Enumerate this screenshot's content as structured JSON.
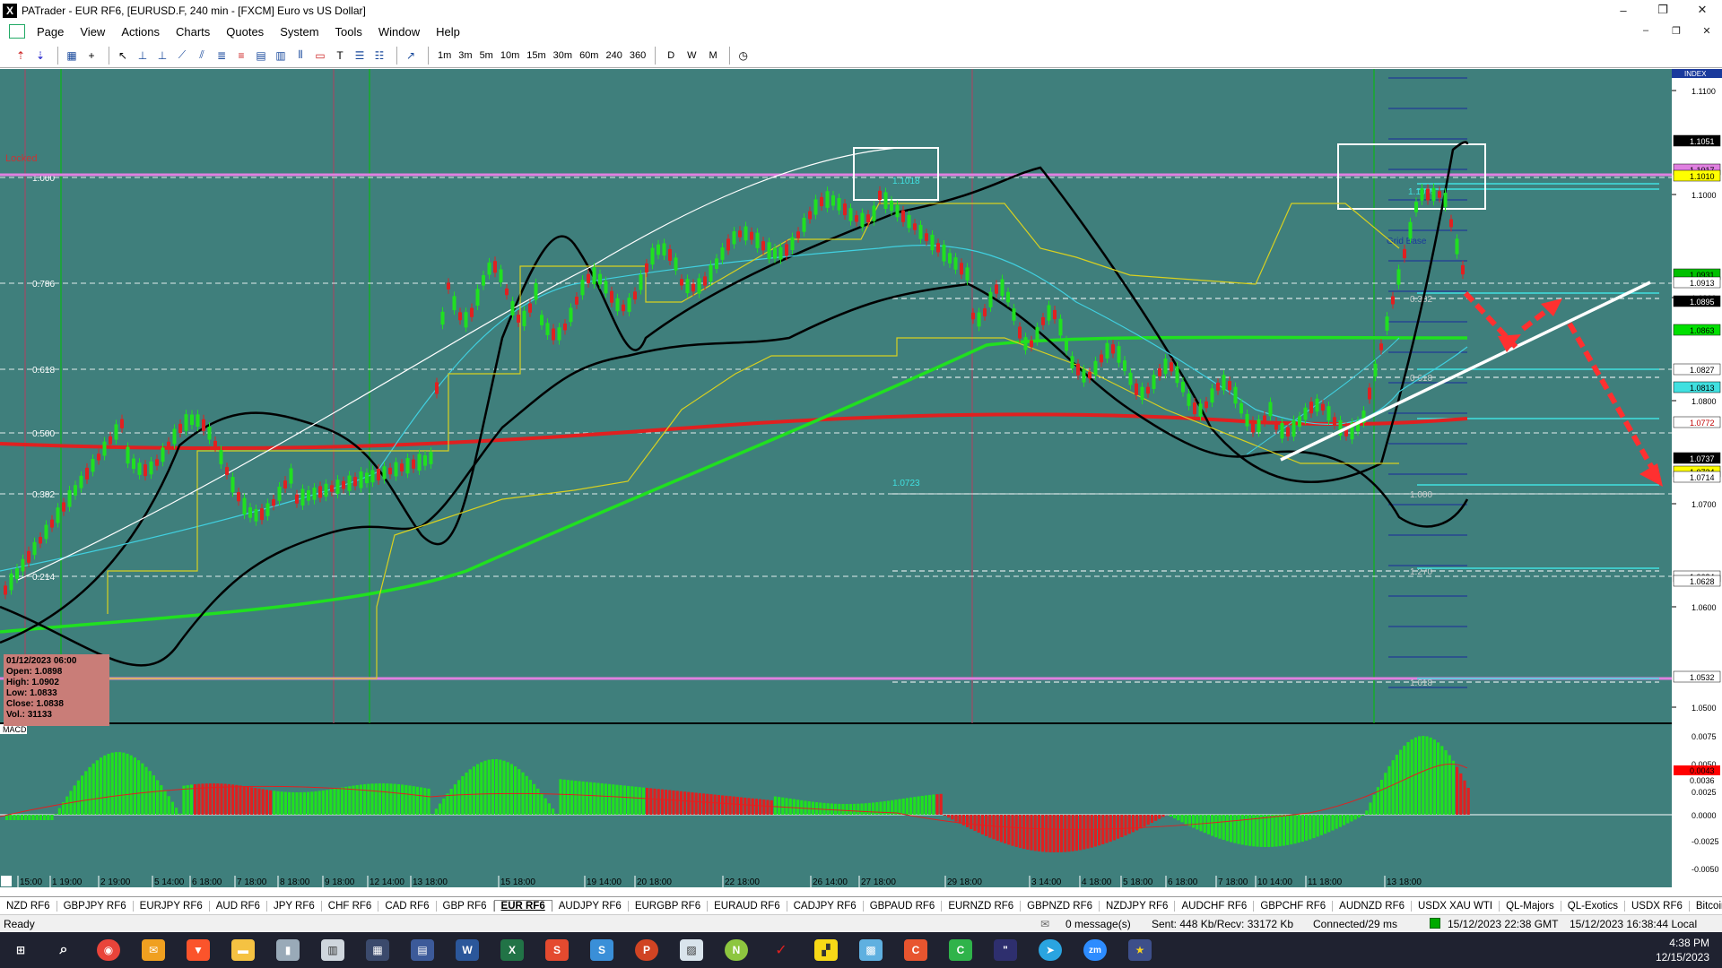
{
  "window": {
    "app_logo": "X",
    "title": "PATrader - EUR RF6, [EURUSD.F, 240 min - [FXCM] Euro vs US Dollar]",
    "minimize": "–",
    "restore": "❐",
    "close": "✕",
    "child_minimize": "–",
    "child_restore": "❐",
    "child_close": "✕"
  },
  "menu": [
    "Page",
    "View",
    "Actions",
    "Charts",
    "Quotes",
    "System",
    "Tools",
    "Window",
    "Help"
  ],
  "toolbar": {
    "timeframes": [
      "1m",
      "3m",
      "5m",
      "10m",
      "15m",
      "30m",
      "60m",
      "240",
      "360"
    ],
    "periods": [
      "D",
      "W",
      "M"
    ]
  },
  "chart": {
    "locked_label": "Locked",
    "index_label": "INDEX",
    "macd_label": "MACD",
    "price_scale": [
      "1.1100",
      "1.1000",
      "1.0900",
      "1.0800",
      "1.0700",
      "1.0600",
      "1.0500"
    ],
    "price_tags": [
      {
        "text": "1.1051",
        "bg": "#000000",
        "fg": "#ffffff"
      },
      {
        "text": "1.1017",
        "bg": "#e080e0",
        "fg": "#000000"
      },
      {
        "text": "1.1010",
        "bg": "#ffff00",
        "fg": "#000000"
      },
      {
        "text": "1.0931",
        "bg": "#00c000",
        "fg": "#000000"
      },
      {
        "text": "1.0913",
        "bg": "#ffffff",
        "fg": "#000000"
      },
      {
        "text": "1.0895",
        "bg": "#000000",
        "fg": "#ffffff"
      },
      {
        "text": "1.0863",
        "bg": "#00e000",
        "fg": "#000000"
      },
      {
        "text": "1.0827",
        "bg": "#ffffff",
        "fg": "#000000"
      },
      {
        "text": "1.0813",
        "bg": "#40e0e0",
        "fg": "#000000"
      },
      {
        "text": "1.0772",
        "bg": "#ffffff",
        "fg": "#c00000"
      },
      {
        "text": "1.0737",
        "bg": "#000000",
        "fg": "#ffffff"
      },
      {
        "text": "1.0724",
        "bg": "#ffff00",
        "fg": "#000000"
      },
      {
        "text": "1.0714",
        "bg": "#ffffff",
        "fg": "#000000"
      },
      {
        "text": "1.0634",
        "bg": "#ffffff",
        "fg": "#000000"
      },
      {
        "text": "1.0628",
        "bg": "#ffffff",
        "fg": "#000000"
      },
      {
        "text": "1.0532",
        "bg": "#ffffff",
        "fg": "#000000"
      }
    ],
    "fib_left": [
      "1.000",
      "0.786",
      "0.618",
      "0.500",
      "0.382",
      "0.214"
    ],
    "fib_right": [
      "0.382",
      "0.618",
      "1.000",
      "1.270",
      "1.618"
    ],
    "fib_mid": [
      "1.1018",
      "1.0723",
      "1.1009",
      "Grid Base"
    ],
    "time_labels": [
      "15:00",
      "1 19:00",
      "2 19:00",
      "5 14:00",
      "6 18:00",
      "7 18:00",
      "8 18:00",
      "9 18:00",
      "12 14:00",
      "13 18:00",
      "15 18:00",
      "19 14:00",
      "20 18:00",
      "22 18:00",
      "26 14:00",
      "27 18:00",
      "29 18:00",
      "3 14:00",
      "4 18:00",
      "5 18:00",
      "6 18:00",
      "7 18:00",
      "10 14:00",
      "11 18:00",
      "13 18:00"
    ],
    "macd_scale": [
      "0.0075",
      "0.0050",
      "0.0025",
      "0.0000",
      "-0.0025",
      "-0.0050"
    ],
    "macd_tags": [
      {
        "text": "0.0043",
        "bg": "#ff0000",
        "fg": "#000000"
      },
      {
        "text": "0.0036",
        "bg": "#ffffff",
        "fg": "#000000"
      }
    ]
  },
  "ohlc": {
    "date": "01/12/2023 06:00",
    "open": "Open: 1.0898",
    "high": "High: 1.0902",
    "low": "Low: 1.0833",
    "close": "Close: 1.0838",
    "vol": "Vol.: 31133"
  },
  "symbol_tabs": [
    "NZD RF6",
    "GBPJPY RF6",
    "EURJPY RF6",
    "AUD RF6",
    "JPY RF6",
    "CHF RF6",
    "CAD RF6",
    "GBP RF6",
    "EUR RF6",
    "AUDJPY RF6",
    "EURGBP RF6",
    "EURAUD RF6",
    "CADJPY RF6",
    "GBPAUD RF6",
    "EURNZD RF6",
    "GBPNZD RF6",
    "NZDJPY RF6",
    "AUDCHF RF6",
    "GBPCHF RF6",
    "AUDNZD RF6",
    "USDX XAU WTI",
    "QL-Majors",
    "QL-Exotics",
    "USDX RF6",
    "Bitcoin",
    "SP500",
    "DJIA"
  ],
  "active_tab": "EUR RF6",
  "status": {
    "ready": "Ready",
    "messages": "0 message(s)",
    "sent": "Sent: 448 Kb/Recv: 33172 Kb",
    "connected": "Connected/29 ms",
    "gmt": "15/12/2023 22:38 GMT",
    "local": "15/12/2023 16:38:44 Local"
  },
  "clock": {
    "time": "4:38 PM",
    "date": "12/15/2023"
  }
}
